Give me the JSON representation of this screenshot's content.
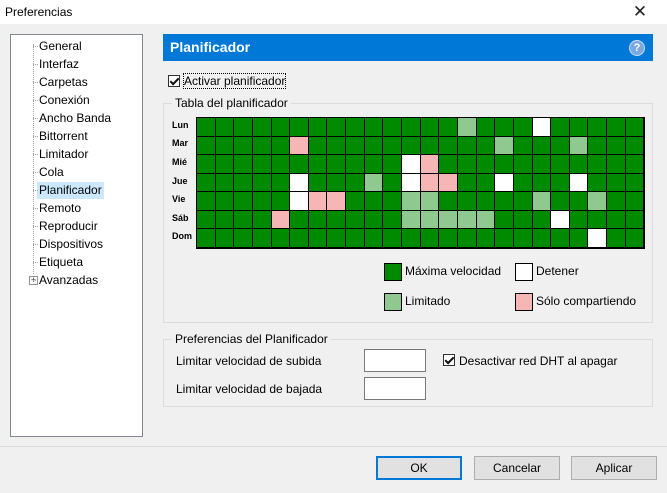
{
  "window": {
    "title": "Preferencias",
    "close_glyph": "✕"
  },
  "sidebar": {
    "items": [
      {
        "label": "General"
      },
      {
        "label": "Interfaz"
      },
      {
        "label": "Carpetas"
      },
      {
        "label": "Conexión"
      },
      {
        "label": "Ancho Banda"
      },
      {
        "label": "Bittorrent"
      },
      {
        "label": "Limitador"
      },
      {
        "label": "Cola"
      },
      {
        "label": "Planificador",
        "selected": true
      },
      {
        "label": "Remoto"
      },
      {
        "label": "Reproducir"
      },
      {
        "label": "Dispositivos"
      },
      {
        "label": "Etiqueta"
      },
      {
        "label": "Avanzadas",
        "expandable": true
      }
    ]
  },
  "panel": {
    "title": "Planificador",
    "help_icon": "?",
    "enable_scheduler": {
      "label": "Activar planificador",
      "checked": true
    },
    "schedule_table": {
      "legend": "Tabla del planificador",
      "days": [
        "Lun",
        "Mar",
        "Mié",
        "Jue",
        "Vie",
        "Sáb",
        "Dom"
      ],
      "rows": [
        "FFFFFFFFFFFFFFLFFFSFFFFF",
        "FFFFFCFFFFFFFFFFLFFFLFFF",
        "FFFFFFFFFFFSCFFFFFFFFFFF",
        "FFFFFSFFFLFSCCFFSFFFSFFF",
        "FFFFFSCCFFFLLFFFFFLFFLFF",
        "FFFFCFFFFFFLLLLLFFFSFFFF",
        "FFFFFFFFFFFFFFFFFFFFFSFF"
      ],
      "colors": {
        "full": "#008a00",
        "limited": "#8fc98f",
        "stop": "#ffffff",
        "seed": "#f7b6b6"
      },
      "legend_items": {
        "full": "Máxima velocidad",
        "stop": "Detener",
        "limited": "Limitado",
        "seed": "Sólo compartiendo"
      }
    },
    "preferences": {
      "legend": "Preferencias del Planificador",
      "upload_label": "Limitar velocidad de subida",
      "upload_value": "",
      "download_label": "Limitar velocidad de bajada",
      "download_value": "",
      "dht_off": {
        "label": "Desactivar red DHT al apagar",
        "checked": true
      }
    }
  },
  "buttons": {
    "ok": "OK",
    "cancel": "Cancelar",
    "apply": "Aplicar"
  }
}
